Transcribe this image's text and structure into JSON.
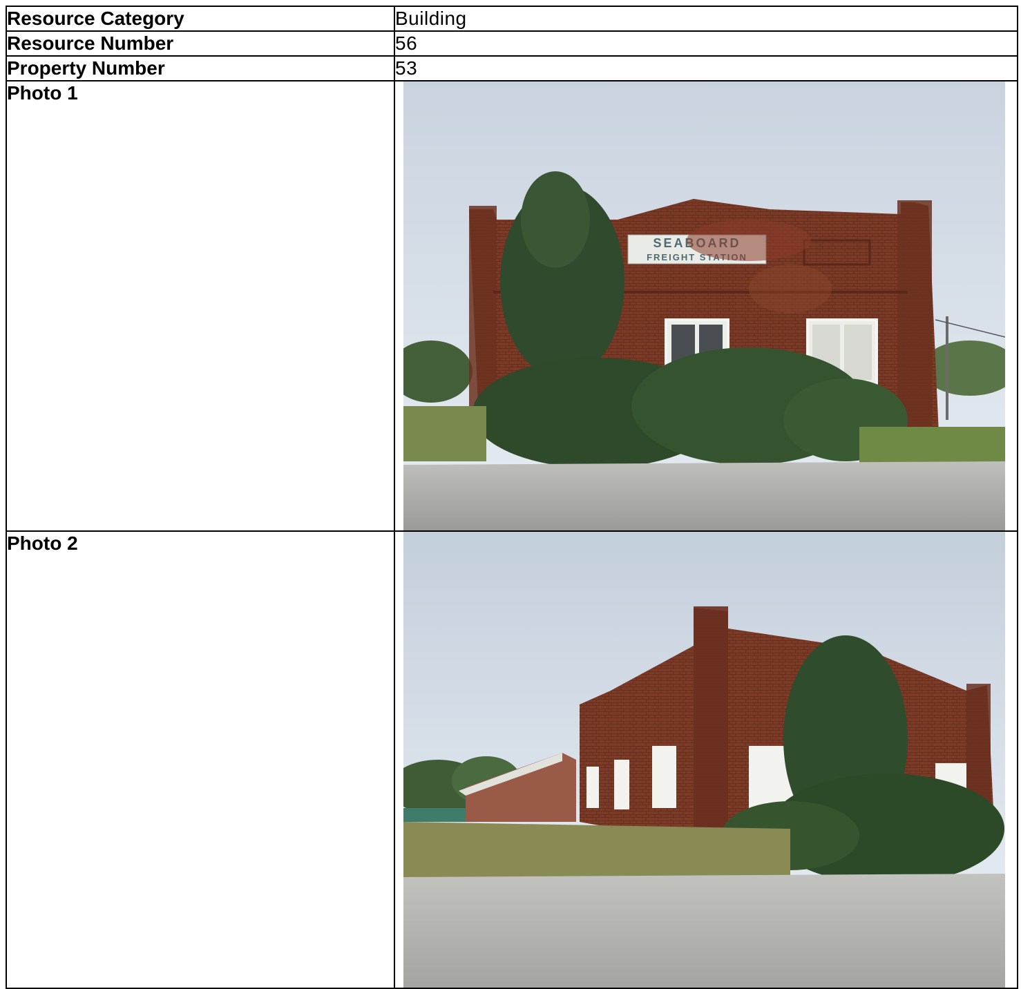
{
  "rows": [
    {
      "label": "Resource Category",
      "value": "Building"
    },
    {
      "label": "Resource Number",
      "value": "56"
    },
    {
      "label": "Property Number",
      "value": "53"
    }
  ],
  "photos": [
    {
      "label": "Photo 1",
      "sign_line1": "SEABOARD",
      "sign_line2": "FREIGHT STATION"
    },
    {
      "label": "Photo 2"
    }
  ]
}
